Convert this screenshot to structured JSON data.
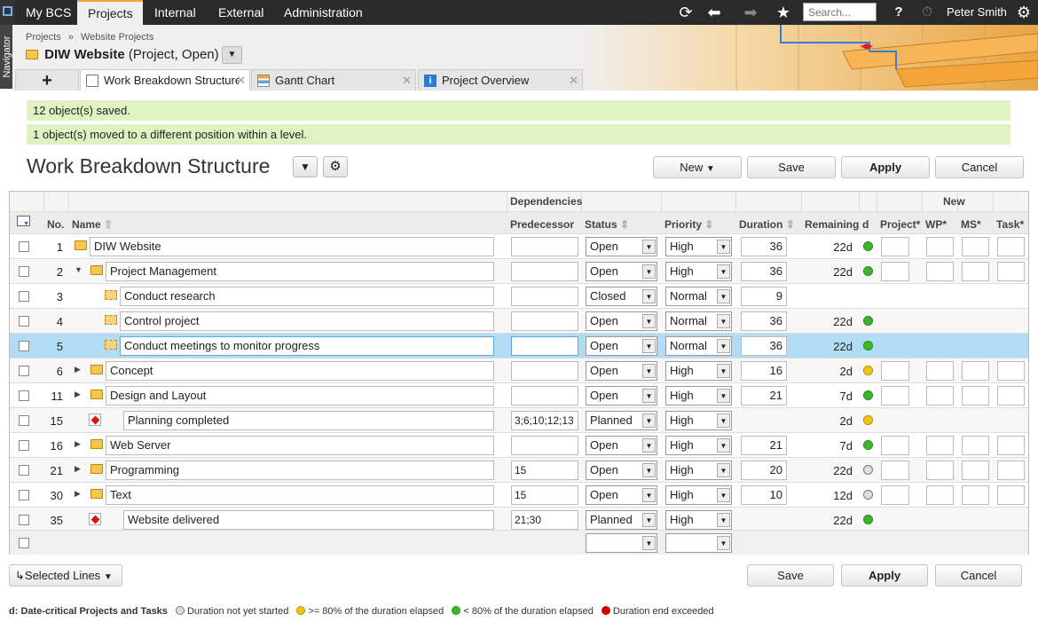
{
  "topbar": {
    "tabs": [
      "My BCS",
      "Projects",
      "Internal",
      "External",
      "Administration"
    ],
    "active_tab": "Projects",
    "search_placeholder": "Search...",
    "help": "?",
    "user": "Peter Smith"
  },
  "navigator_label": "Navigator",
  "header": {
    "breadcrumb_root": "Projects",
    "breadcrumb_sep": "»",
    "breadcrumb_leaf": "Website Projects",
    "project_name": "DIW Website",
    "project_state": "(Project, Open)",
    "add_tab": "+",
    "tabs": [
      {
        "label": "Work Breakdown Structure",
        "icon": "wbs-icon"
      },
      {
        "label": "Gantt Chart",
        "icon": "gantt-icon"
      },
      {
        "label": "Project Overview",
        "icon": "info-icon"
      }
    ]
  },
  "messages": [
    "12 object(s) saved.",
    "1 object(s) moved to a different position within a level."
  ],
  "page_title": "Work Breakdown Structure",
  "actions": {
    "new": "New",
    "save": "Save",
    "apply": "Apply",
    "cancel": "Cancel"
  },
  "grid": {
    "group_dependencies": "Dependencies",
    "group_new": "New",
    "headers": {
      "no": "No.",
      "name": "Name",
      "predecessor": "Predecessor",
      "status": "Status",
      "priority": "Priority",
      "duration": "Duration",
      "remaining": "Remaining",
      "d": "d",
      "project": "Project*",
      "wp": "WP*",
      "ms": "MS*",
      "task": "Task*"
    },
    "rows": [
      {
        "no": "1",
        "level": 0,
        "expand": "",
        "type": "folder",
        "name": "DIW Website",
        "pred": "",
        "status": "Open",
        "priority": "High",
        "duration": "36",
        "remaining": "22d",
        "d": "g",
        "newcols": true
      },
      {
        "no": "2",
        "level": 1,
        "expand": "▼",
        "type": "folder",
        "name": "Project Management",
        "pred": "",
        "status": "Open",
        "priority": "High",
        "duration": "36",
        "remaining": "22d",
        "d": "g",
        "newcols": true
      },
      {
        "no": "3",
        "level": 2,
        "expand": "",
        "type": "task",
        "name": "Conduct research",
        "pred": "",
        "status": "Closed",
        "priority": "Normal",
        "duration": "9",
        "remaining": "",
        "d": "",
        "newcols": false
      },
      {
        "no": "4",
        "level": 2,
        "expand": "",
        "type": "task",
        "name": "Control project",
        "pred": "",
        "status": "Open",
        "priority": "Normal",
        "duration": "36",
        "remaining": "22d",
        "d": "g",
        "newcols": false
      },
      {
        "no": "5",
        "level": 2,
        "expand": "",
        "type": "task",
        "name": "Conduct meetings to monitor progress",
        "pred": "",
        "status": "Open",
        "priority": "Normal",
        "duration": "36",
        "remaining": "22d",
        "d": "g",
        "newcols": false,
        "selected": true
      },
      {
        "no": "6",
        "level": 1,
        "expand": "▶",
        "type": "folder",
        "name": "Concept",
        "pred": "",
        "status": "Open",
        "priority": "High",
        "duration": "16",
        "remaining": "2d",
        "d": "y",
        "newcols": true
      },
      {
        "no": "11",
        "level": 1,
        "expand": "▶",
        "type": "folder",
        "name": "Design and Layout",
        "pred": "",
        "status": "Open",
        "priority": "High",
        "duration": "21",
        "remaining": "7d",
        "d": "g",
        "newcols": true
      },
      {
        "no": "15",
        "level": 1,
        "expand": "",
        "type": "milestone",
        "name": "Planning completed",
        "pred": "3;6;10;12;13",
        "status": "Planned",
        "priority": "High",
        "duration": "",
        "remaining": "2d",
        "d": "y",
        "newcols": false
      },
      {
        "no": "16",
        "level": 1,
        "expand": "▶",
        "type": "folder",
        "name": "Web Server",
        "pred": "",
        "status": "Open",
        "priority": "High",
        "duration": "21",
        "remaining": "7d",
        "d": "g",
        "newcols": true
      },
      {
        "no": "21",
        "level": 1,
        "expand": "▶",
        "type": "folder",
        "name": "Programming",
        "pred": "15",
        "status": "Open",
        "priority": "High",
        "duration": "20",
        "remaining": "22d",
        "d": "o",
        "newcols": true
      },
      {
        "no": "30",
        "level": 1,
        "expand": "▶",
        "type": "folder",
        "name": "Text",
        "pred": "15",
        "status": "Open",
        "priority": "High",
        "duration": "10",
        "remaining": "12d",
        "d": "o",
        "newcols": true
      },
      {
        "no": "35",
        "level": 1,
        "expand": "",
        "type": "milestone",
        "name": "Website delivered",
        "pred": "21;30",
        "status": "Planned",
        "priority": "High",
        "duration": "",
        "remaining": "22d",
        "d": "g",
        "newcols": false
      }
    ]
  },
  "footer": {
    "selected_lines": "Selected Lines",
    "legend_title": "d: Date-critical Projects and Tasks",
    "legend": [
      {
        "label": "Duration not yet started",
        "color": "#dddddd"
      },
      {
        "label": ">= 80% of the duration elapsed",
        "color": "#f6c40d"
      },
      {
        "label": "< 80% of the duration elapsed",
        "color": "#39b829"
      },
      {
        "label": "Duration end exceeded",
        "color": "#d40000"
      }
    ]
  },
  "colors": {
    "accent": "#f3a53a",
    "message_bg": "#dff2c2",
    "selected_row": "#b2dcf4"
  }
}
